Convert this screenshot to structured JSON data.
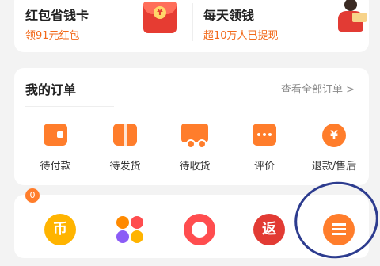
{
  "promo": {
    "left": {
      "title": "红包省钱卡",
      "subtitle": "领91元红包",
      "icon": "red-envelope-icon",
      "coin": "¥"
    },
    "right": {
      "title": "每天领钱",
      "subtitle": "超10万人已提现",
      "icon": "person-holding-cash-icon"
    }
  },
  "orders": {
    "title": "我的订单",
    "view_all": "查看全部订单 >",
    "items": [
      {
        "label": "待付款",
        "icon": "wallet-icon"
      },
      {
        "label": "待发货",
        "icon": "box-icon"
      },
      {
        "label": "待收货",
        "icon": "truck-icon"
      },
      {
        "label": "评价",
        "icon": "comment-icon"
      },
      {
        "label": "退款/售后",
        "icon": "refund-icon"
      }
    ]
  },
  "bottom": {
    "badge": "0",
    "items": [
      {
        "text": "币",
        "icon": "coin-icon",
        "color": "#ffb400"
      },
      {
        "text": "",
        "icon": "grid-apps-icon",
        "color": "#ff8a00"
      },
      {
        "text": "",
        "icon": "medal-icon",
        "color": "#ff4d4f"
      },
      {
        "text": "返",
        "icon": "rebate-icon",
        "color": "#e23b34"
      },
      {
        "text": "",
        "icon": "menu-list-icon",
        "color": "#ff7d2b"
      }
    ]
  },
  "colors": {
    "accent": "#ff7d2b",
    "subtitle": "#f26a1b",
    "annotation": "#2d3c8f"
  }
}
